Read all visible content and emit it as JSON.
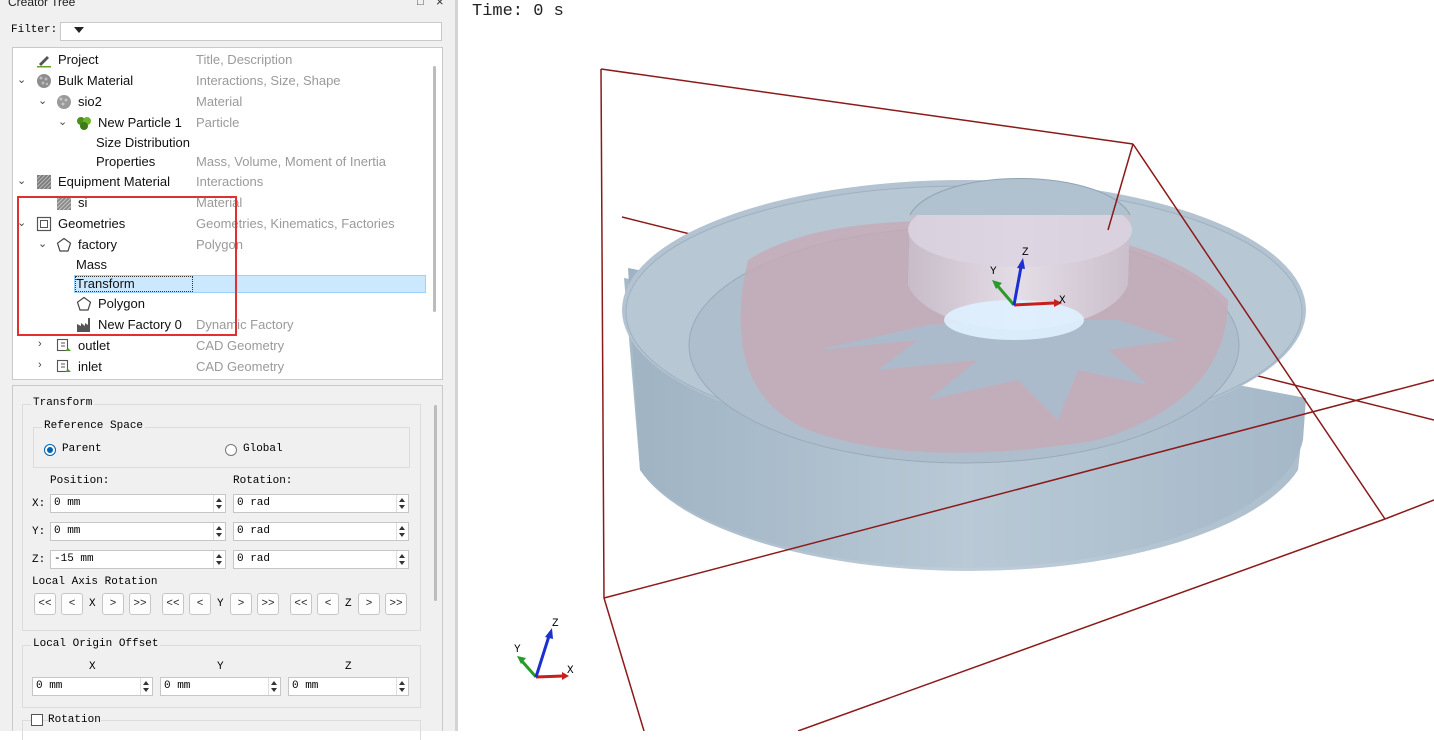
{
  "panel": {
    "title": "Creator Tree",
    "float_icon": "□",
    "close_icon": "×",
    "filter_label": "Filter:"
  },
  "tree": [
    {
      "label": "Project",
      "desc": "Title, Description",
      "icon": "pencil-icon"
    },
    {
      "label": "Bulk Material",
      "desc": "Interactions, Size, Shape",
      "icon": "sphere-icon"
    },
    {
      "label": "sio2",
      "desc": "Material",
      "icon": "sphere-icon"
    },
    {
      "label": "New Particle 1",
      "desc": "Particle",
      "icon": "particle-icon"
    },
    {
      "label": "Size Distribution",
      "desc": "",
      "icon": ""
    },
    {
      "label": "Properties",
      "desc": "Mass, Volume, Moment of Inertia",
      "icon": ""
    },
    {
      "label": "Equipment Material",
      "desc": "Interactions",
      "icon": "hatched-square-icon"
    },
    {
      "label": "si",
      "desc": "Material",
      "icon": "hatched-square-icon"
    },
    {
      "label": "Geometries",
      "desc": "Geometries, Kinematics, Factories",
      "icon": "geometry-box-icon"
    },
    {
      "label": "factory",
      "desc": "Polygon",
      "icon": "pentagon-icon"
    },
    {
      "label": "Mass",
      "desc": "",
      "icon": ""
    },
    {
      "label": "Transform",
      "desc": "",
      "icon": ""
    },
    {
      "label": "Polygon",
      "desc": "",
      "icon": "pentagon-icon"
    },
    {
      "label": "New Factory 0",
      "desc": "Dynamic Factory",
      "icon": "factory-icon"
    },
    {
      "label": "outlet",
      "desc": "CAD Geometry",
      "icon": "cad-geometry-icon"
    },
    {
      "label": "inlet",
      "desc": "CAD Geometry",
      "icon": "cad-geometry-icon"
    }
  ],
  "transform": {
    "title": "Transform",
    "reference_space": {
      "title": "Reference Space",
      "parent_label": "Parent",
      "global_label": "Global",
      "selected": "Parent"
    },
    "position_label": "Position:",
    "rotation_label": "Rotation:",
    "axis_labels": [
      "X:",
      "Y:",
      "Z:"
    ],
    "position_values": [
      "0 mm",
      "0 mm",
      "-15 mm"
    ],
    "rotation_values": [
      "0 rad",
      "0 rad",
      "0 rad"
    ],
    "local_axis_rotation_label": "Local Axis Rotation",
    "axis_letters": [
      "X",
      "Y",
      "Z"
    ],
    "step_buttons": [
      "<<",
      "<",
      ">",
      ">>"
    ]
  },
  "local_origin_offset": {
    "title": "Local Origin Offset",
    "axes": [
      "X",
      "Y",
      "Z"
    ],
    "values": [
      "0 mm",
      "0 mm",
      "0 mm"
    ]
  },
  "rotation_section": {
    "label": "Rotation",
    "checked": false
  },
  "viewport": {
    "time_label": "Time: 0 s",
    "axes_labels": {
      "x": "X",
      "y": "Y",
      "z": "Z"
    }
  },
  "colors": {
    "selection_bg": "#cce8ff",
    "annotation_red": "#e03030",
    "bounding_box": "#8b1a1a",
    "body_fill": "#a9bccb",
    "cross_section": "#c7a7b4"
  }
}
